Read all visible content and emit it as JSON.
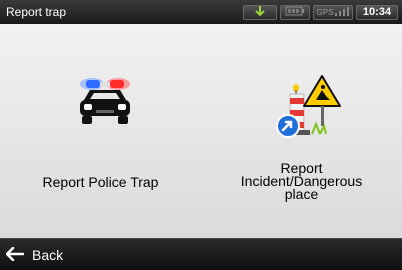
{
  "title_bar": {
    "title": "Report trap",
    "status": {
      "gps_icon": "satellite-antenna-icon",
      "battery_icon": "battery-icon",
      "signal_label": "GPS",
      "time": "10:34"
    }
  },
  "main": {
    "options": [
      {
        "label": "Report Police Trap",
        "icon": "police-car-icon"
      },
      {
        "label": "Report\nIncident/Dangerous\nplace",
        "icon": "incident-warning-icon"
      }
    ]
  },
  "bottom_bar": {
    "back_label": "Back",
    "back_icon": "arrow-left-icon"
  },
  "colors": {
    "titlebar_bg": "#1a1a1a",
    "main_bg": "#e4e4e4",
    "accent_green": "#7ec31a",
    "police_blue": "#2f6bff",
    "police_red": "#ff2a2a"
  }
}
